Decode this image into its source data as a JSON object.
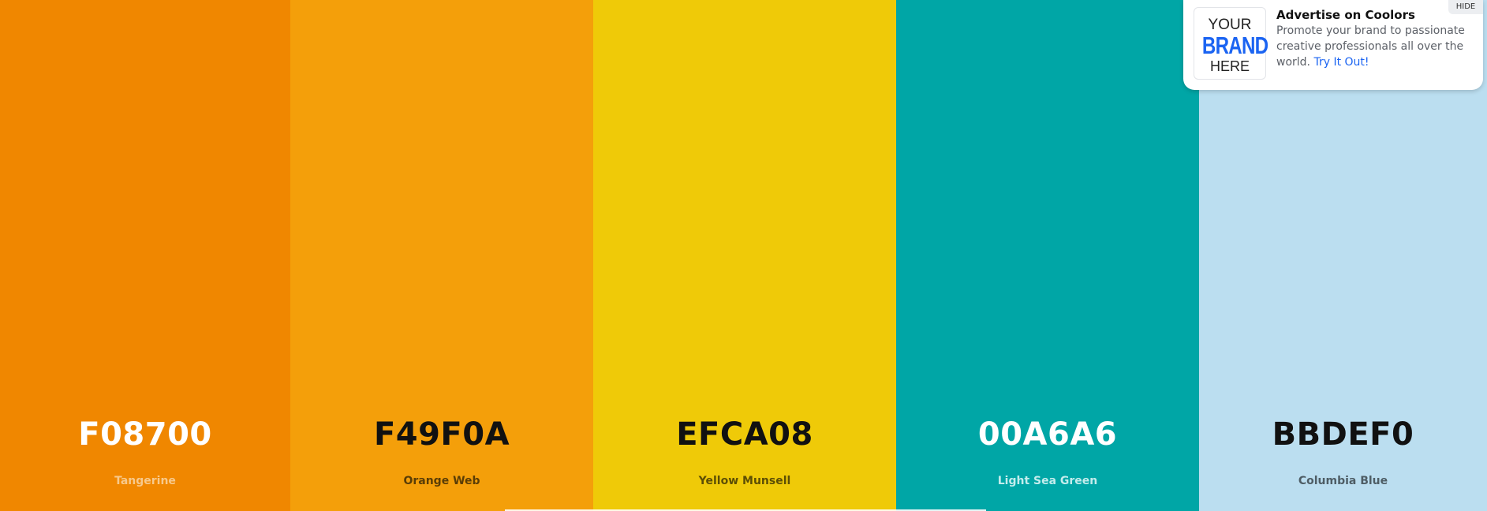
{
  "palette": {
    "swatches": [
      {
        "hex": "F08700",
        "name": "Tangerine",
        "color": "#F08700",
        "hex_text_color": "#ffffff",
        "name_text_color": "#f7c98c"
      },
      {
        "hex": "F49F0A",
        "name": "Orange Web",
        "color": "#F49F0A",
        "hex_text_color": "#111111",
        "name_text_color": "#5a3d06"
      },
      {
        "hex": "EFCA08",
        "name": "Yellow Munsell",
        "color": "#EFCA08",
        "hex_text_color": "#111111",
        "name_text_color": "#5c4e05"
      },
      {
        "hex": "00A6A6",
        "name": "Light Sea Green",
        "color": "#00A6A6",
        "hex_text_color": "#ffffff",
        "name_text_color": "#c4ecec"
      },
      {
        "hex": "BBDEF0",
        "name": "Columbia Blue",
        "color": "#BBDEF0",
        "hex_text_color": "#111111",
        "name_text_color": "#4e5d65"
      }
    ]
  },
  "ad": {
    "logo": {
      "top": "YOUR",
      "middle": "BRAND",
      "bottom": "HERE"
    },
    "title": "Advertise on Coolors",
    "body": "Promote your brand to passionate creative professionals all over the world.",
    "link_label": "Try It Out!",
    "hide_label": "HIDE"
  }
}
